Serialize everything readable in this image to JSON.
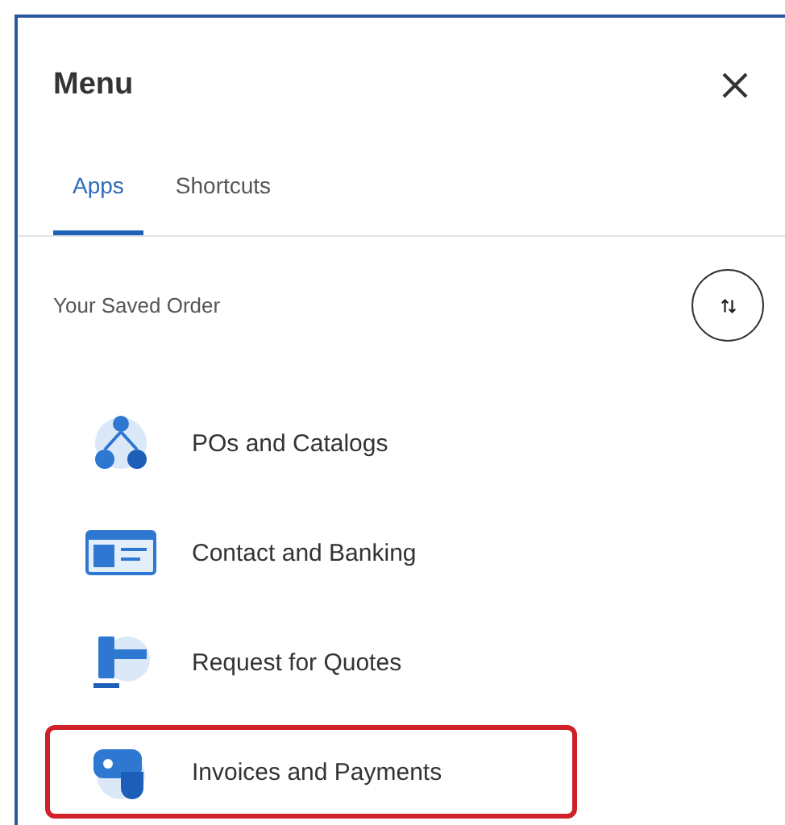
{
  "panel": {
    "title": "Menu"
  },
  "tabs": [
    {
      "label": "Apps",
      "selected": true
    },
    {
      "label": "Shortcuts",
      "selected": false
    }
  ],
  "section": {
    "label": "Your Saved Order"
  },
  "items": [
    {
      "label": "POs and Catalogs",
      "kind": "network",
      "highlighted": false
    },
    {
      "label": "Contact and Banking",
      "kind": "card",
      "highlighted": false
    },
    {
      "label": "Request for Quotes",
      "kind": "desk",
      "highlighted": false
    },
    {
      "label": "Invoices and Payments",
      "kind": "payment",
      "highlighted": true
    }
  ]
}
